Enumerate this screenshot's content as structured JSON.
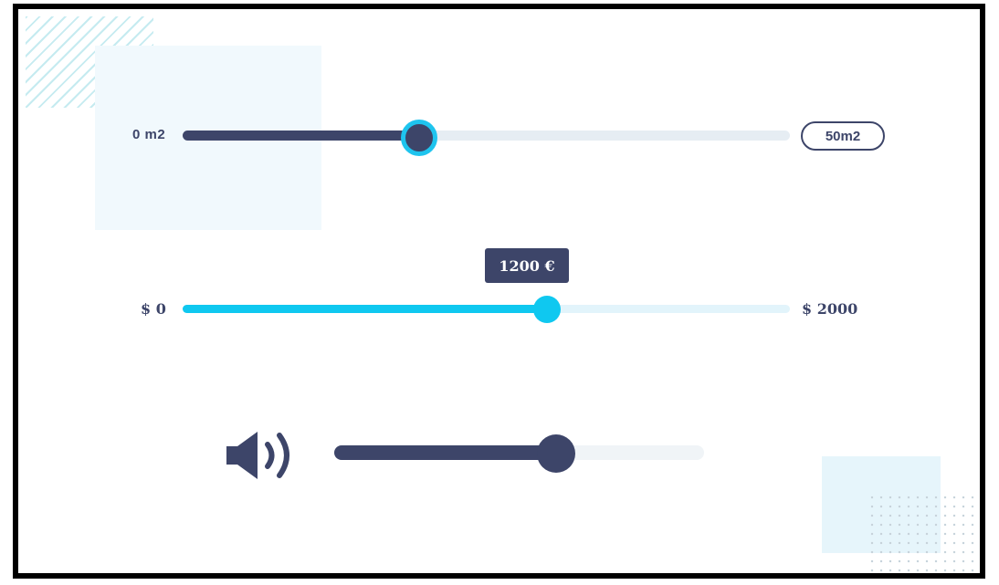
{
  "area_slider": {
    "min_label": "0 m2",
    "max_label": "50m2",
    "value_fraction": 0.39
  },
  "price_slider": {
    "min_label": "$ 0",
    "max_label": "$ 2000",
    "value": 1200,
    "max": 2000,
    "tooltip": "1200 €"
  },
  "volume_slider": {
    "icon": "speaker-volume-icon",
    "value_fraction": 0.6
  },
  "colors": {
    "navy": "#3d4569",
    "cyan": "#0fc8f0",
    "track_light": "#e6edf3"
  }
}
